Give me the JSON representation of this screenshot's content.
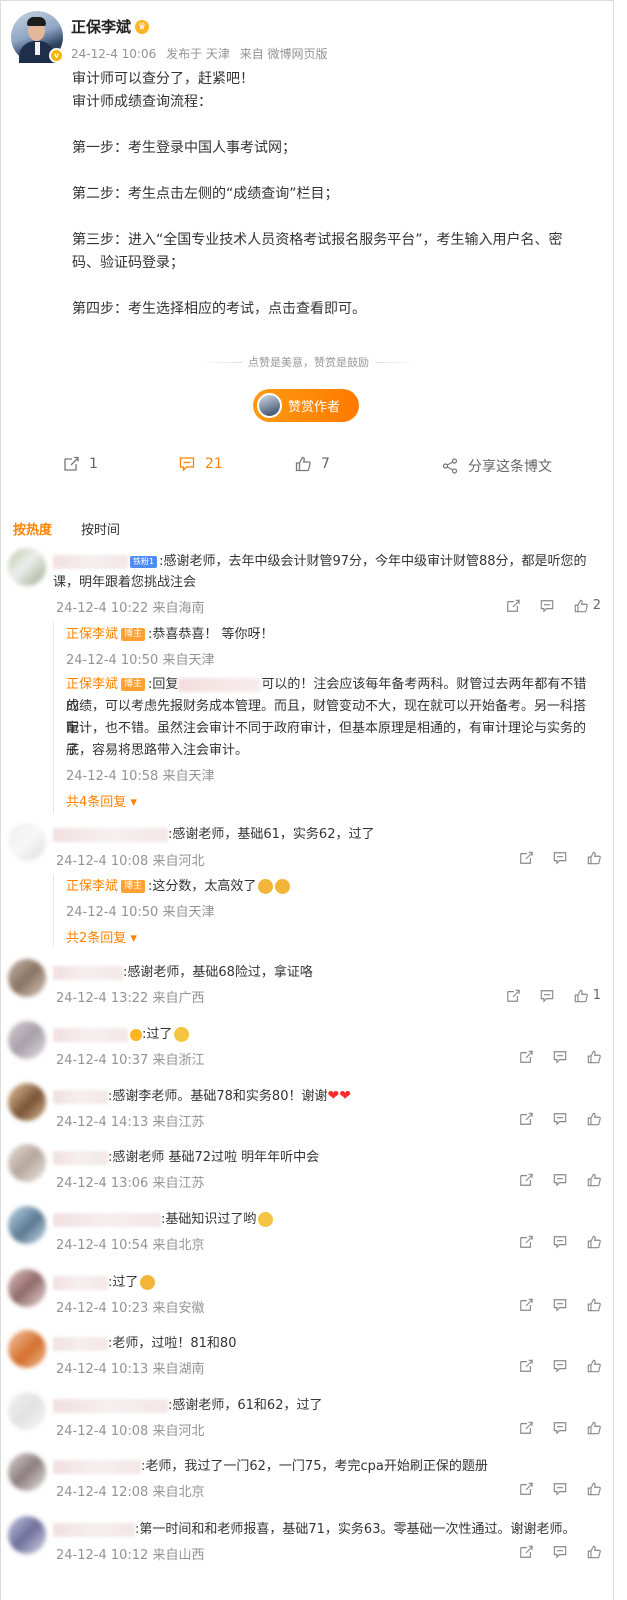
{
  "post": {
    "author": "正保李斌",
    "time": "24-12-4 10:06",
    "publish_from": "发布于 天津",
    "source": "来自 微博网页版",
    "lines": [
      "审计师可以查分了，赶紧吧！",
      "审计师成绩查询流程：",
      "",
      "第一步：考生登录中国人事考试网；",
      "",
      "第二步：考生点击左侧的“成绩查询”栏目；",
      "",
      "第三步：进入“全国专业技术人员资格考试报名服务平台”，考生输入用户名、密",
      "码、验证码登录；",
      "",
      "第四步：考生选择相应的考试，点击查看即可。"
    ],
    "reward_tip": "点赞是美意，赞赏是鼓励",
    "reward_button": "赞赏作者"
  },
  "actions": {
    "repost_count": "1",
    "comment_count": "21",
    "like_count": "7",
    "share_label": "分享这条博文"
  },
  "sort": {
    "hot": "按热度",
    "time": "按时间"
  },
  "colors": {
    "accent": "#ff8200",
    "muted": "#939393"
  },
  "comments": [
    {
      "fan_tag": "铁粉1",
      "text": ":感谢老师，去年中级会计财管97分，今年中级审计财管88分，都是听您的",
      "text2": "课，明年跟着您挑战注会",
      "time": "24-12-4 10:22 来自海南",
      "likes": "2",
      "replies": [
        {
          "author": "正保李斌",
          "badge": "博主",
          "text": ":恭喜恭喜！ 等你呀！",
          "time": "24-12-4 10:50 来自天津"
        },
        {
          "author": "正保李斌",
          "badge": "博主",
          "prefix": ":回复",
          "text": "可以的！注会应该每年备考两科。财管过去两年都有不错的",
          "text2": "成绩，可以考虑先报财务成本管理。而且，财管变动不大，现在就可以开始备考。另一科搭配",
          "text3": "审计，也不错。虽然注会审计不同于政府审计，但基本原理是相通的，有审计理论与实务的底",
          "text4": "子，容易将思路带入注会审计。",
          "time": "24-12-4 10:58 来自天津"
        }
      ],
      "more": "共4条回复"
    },
    {
      "text": ":感谢老师，基础61，实务62，过了",
      "time": "24-12-4 10:08 来自河北",
      "replies": [
        {
          "author": "正保李斌",
          "badge": "博主",
          "text": ":这分数，太高效了",
          "time": "24-12-4 10:50 来自天津"
        }
      ],
      "more": "共2条回复"
    },
    {
      "text": ":感谢老师，基础68险过，拿证咯",
      "time": "24-12-4 13:22 来自广西",
      "likes": "1"
    },
    {
      "text": ":过了",
      "time": "24-12-4 10:37 来自浙江"
    },
    {
      "text": ":感谢李老师。基础78和实务80！谢谢",
      "time": "24-12-4 14:13 来自江苏"
    },
    {
      "text": ":感谢老师 基础72过啦 明年年听中会",
      "time": "24-12-4 13:06 来自江苏"
    },
    {
      "text": ":基础知识过了哟",
      "time": "24-12-4 10:54 来自北京"
    },
    {
      "text": ":过了",
      "time": "24-12-4 10:23 来自安徽"
    },
    {
      "text": ":老师，过啦！81和80",
      "time": "24-12-4 10:13 来自湖南"
    },
    {
      "text": ":感谢老师，61和62，过了",
      "time": "24-12-4 10:08 来自河北"
    },
    {
      "text": ":老师，我过了一门62，一门75，考完cpa开始刷正保的题册",
      "time": "24-12-4 12:08 来自北京"
    },
    {
      "text": ":第一时间和和老师报喜，基础71，实务63。零基础一次性通过。谢谢老师。",
      "time": "24-12-4 10:12 来自山西"
    }
  ]
}
